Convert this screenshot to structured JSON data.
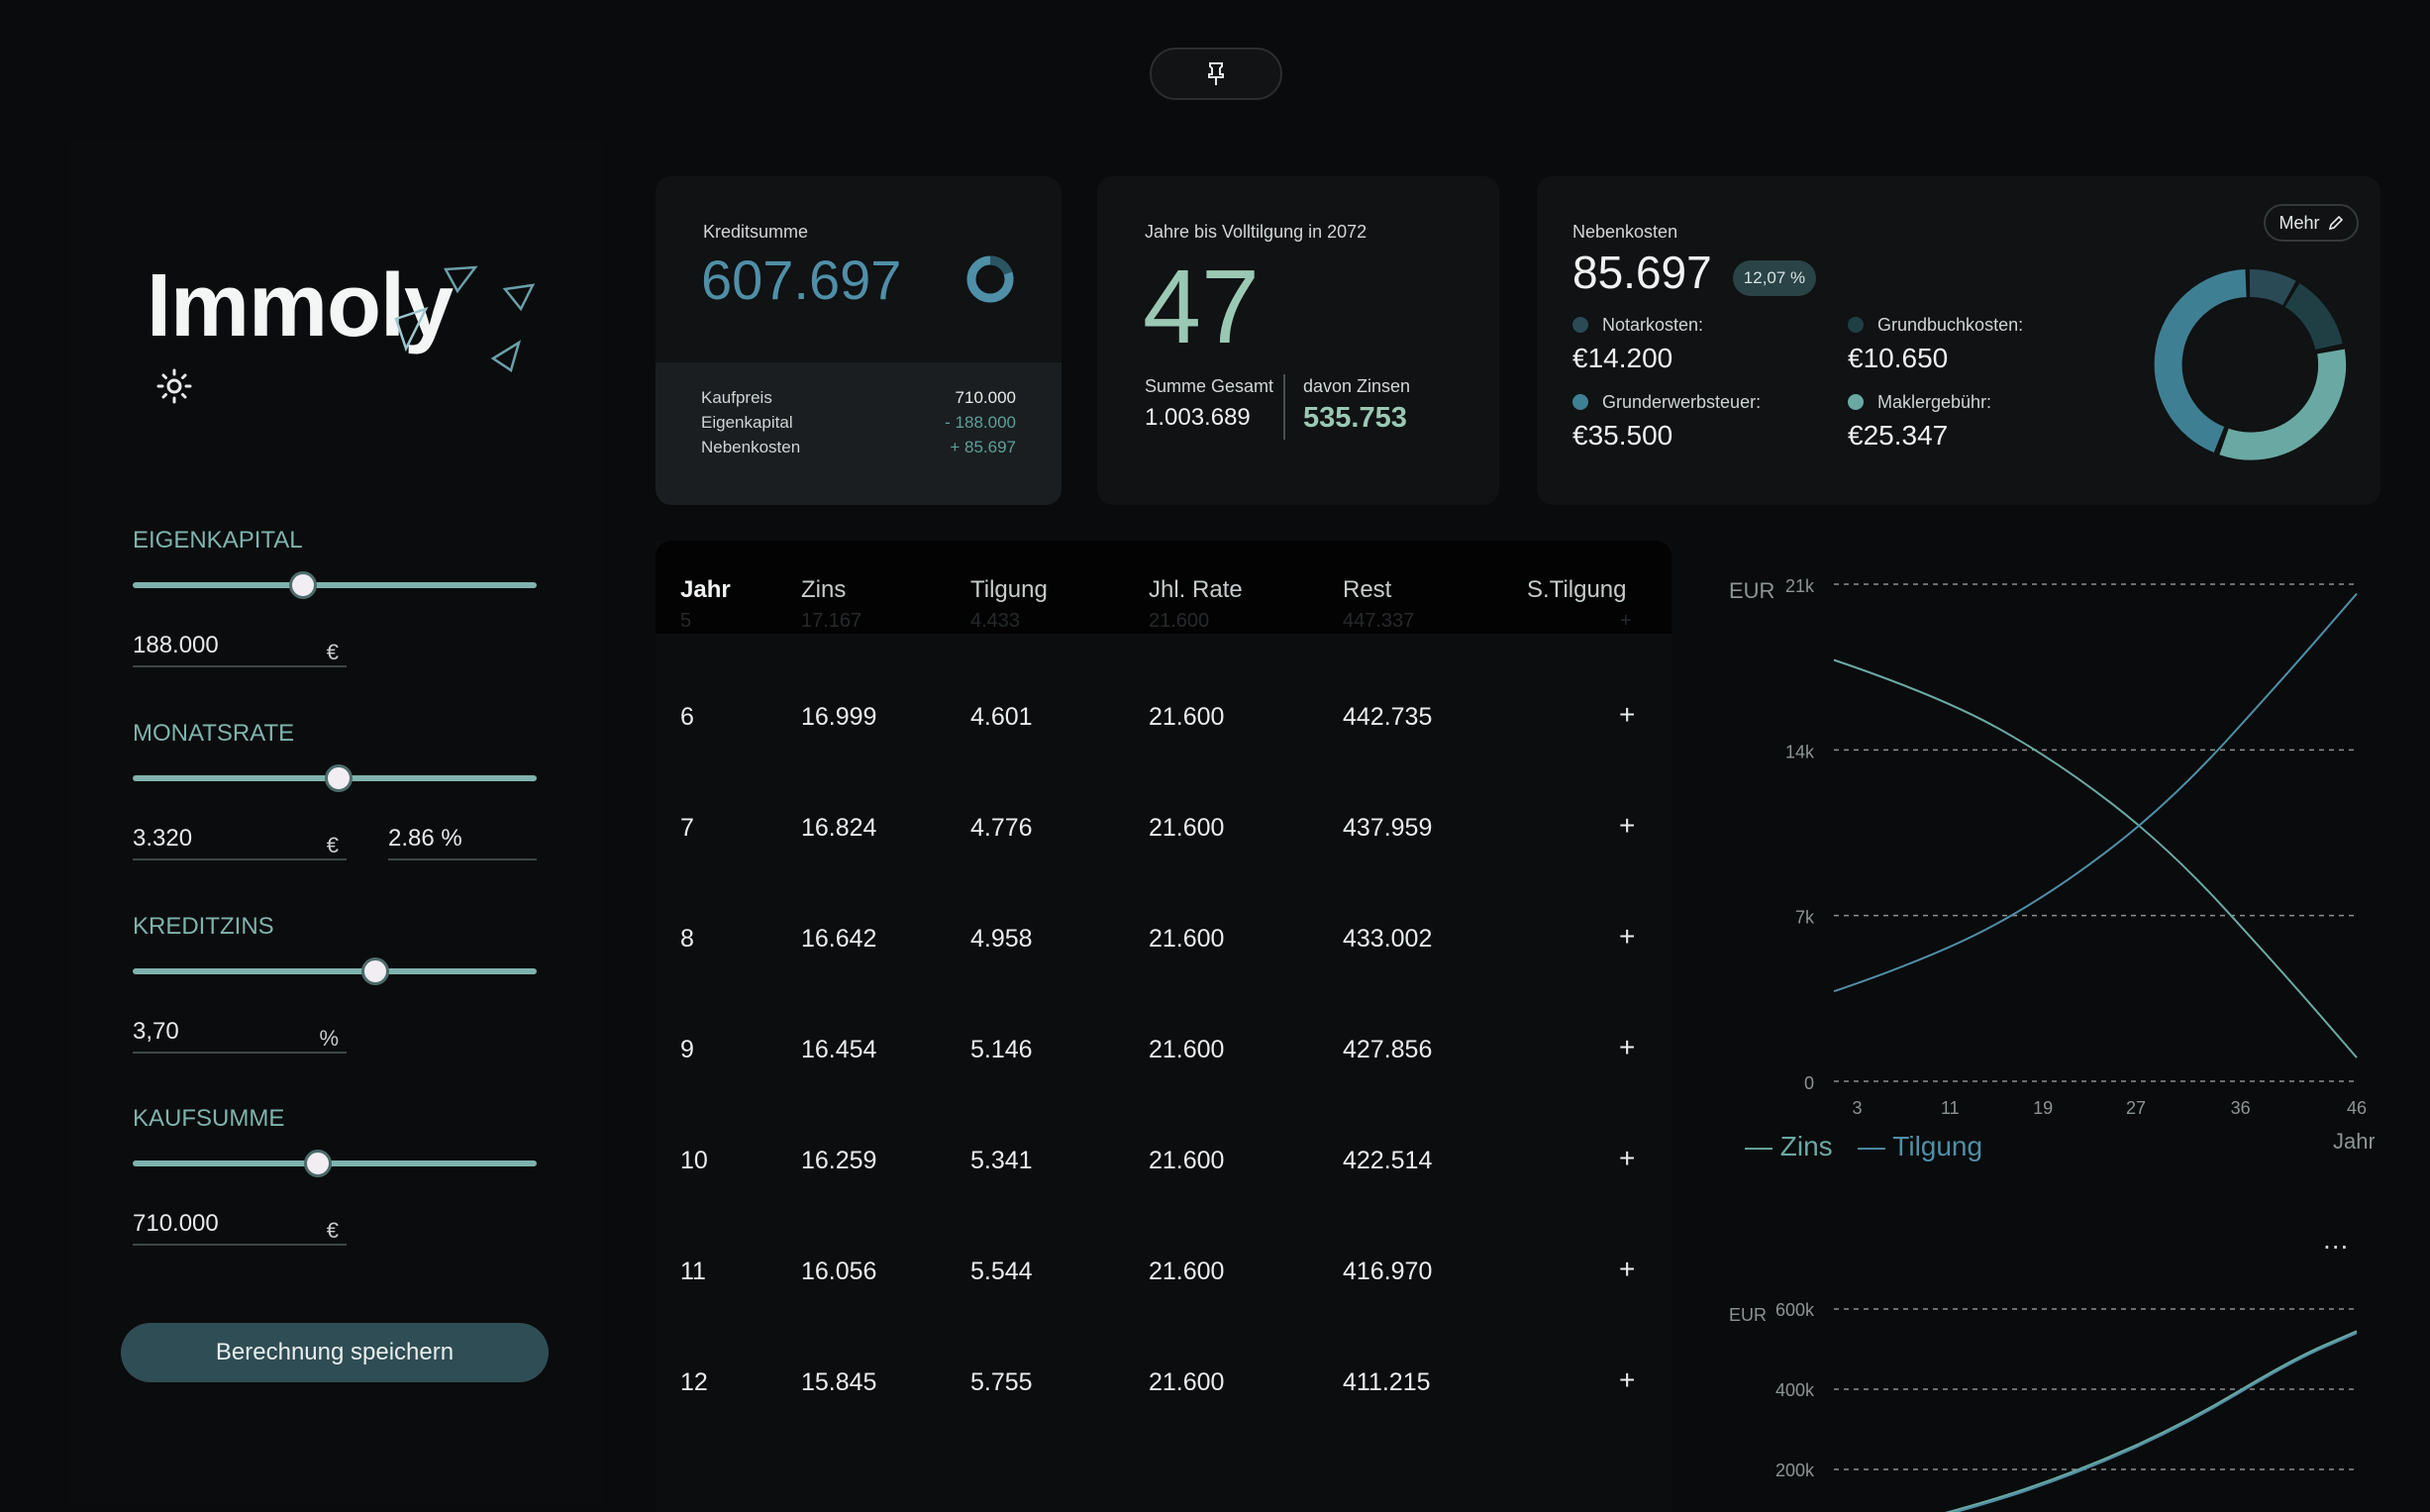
{
  "app": {
    "logo": "Immoly"
  },
  "top_pill": {
    "icon": "pin-icon"
  },
  "sidebar": {
    "controls": [
      {
        "label": "EIGENKAPITAL",
        "value": "188.000",
        "unit": "€",
        "slider_fraction": 0.42
      },
      {
        "label": "MONATSRATE",
        "value": "3.320",
        "unit": "€",
        "extra_value": "2.86 %",
        "slider_fraction": 0.51
      },
      {
        "label": "KREDITZINS",
        "value": "3,70",
        "unit": "%",
        "slider_fraction": 0.6
      },
      {
        "label": "KAUFSUMME",
        "value": "710.000",
        "unit": "€",
        "slider_fraction": 0.46
      }
    ],
    "save_label": "Berechnung speichern"
  },
  "credit_card": {
    "label": "Kreditsumme",
    "value": "607.697",
    "rows": [
      {
        "label": "Kaufpreis",
        "value": "710.000"
      },
      {
        "label": "Eigenkapital",
        "value": "- 188.000"
      },
      {
        "label": "Nebenkosten",
        "value": "+ 85.697"
      }
    ]
  },
  "years_card": {
    "label": "Jahre bis Volltilgung in 2072",
    "value": "47",
    "total_label": "Summe Gesamt",
    "total_value": "1.003.689",
    "interest_label": "davon Zinsen",
    "interest_value": "535.753"
  },
  "costs_card": {
    "label": "Nebenkosten",
    "value": "85.697",
    "badge": "12,07 %",
    "mehr": "Mehr",
    "items": [
      {
        "label": "Notarkosten:",
        "value": "€14.200",
        "color": "#2a4a56"
      },
      {
        "label": "Grundbuchkosten:",
        "value": "€10.650",
        "color": "#1f3f45"
      },
      {
        "label": "Grunderwerbsteuer:",
        "value": "€35.500",
        "color": "#3f7f94"
      },
      {
        "label": "Maklergebühr:",
        "value": "€25.347",
        "color": "#6aa9a3"
      }
    ]
  },
  "table": {
    "headers": [
      "Jahr",
      "Zins",
      "Tilgung",
      "Jhl. Rate",
      "Rest",
      "S.Tilgung"
    ],
    "ghost_row": [
      "5",
      "17.167",
      "4.433",
      "21.600",
      "447.337",
      "+"
    ],
    "rows": [
      [
        "6",
        "16.999",
        "4.601",
        "21.600",
        "442.735",
        "+"
      ],
      [
        "7",
        "16.824",
        "4.776",
        "21.600",
        "437.959",
        "+"
      ],
      [
        "8",
        "16.642",
        "4.958",
        "21.600",
        "433.002",
        "+"
      ],
      [
        "9",
        "16.454",
        "5.146",
        "21.600",
        "427.856",
        "+"
      ],
      [
        "10",
        "16.259",
        "5.341",
        "21.600",
        "422.514",
        "+"
      ],
      [
        "11",
        "16.056",
        "5.544",
        "21.600",
        "416.970",
        "+"
      ],
      [
        "12",
        "15.845",
        "5.755",
        "21.600",
        "411.215",
        "+"
      ]
    ]
  },
  "chart_data": [
    {
      "type": "line",
      "ylabel": "EUR",
      "xlabel": "Jahr",
      "y_ticks": [
        "0",
        "7k",
        "14k",
        "21k"
      ],
      "x_ticks": [
        "3",
        "11",
        "19",
        "27",
        "36",
        "46"
      ],
      "ylim": [
        0,
        21000
      ],
      "xlim": [
        1,
        46
      ],
      "series": [
        {
          "name": "Zins",
          "color": "#6aa9a3",
          "x": [
            1,
            10,
            20,
            30,
            40,
            46
          ],
          "y": [
            17800,
            16300,
            13600,
            9800,
            4400,
            1000
          ]
        },
        {
          "name": "Tilgung",
          "color": "#4f8fa8",
          "x": [
            1,
            10,
            20,
            30,
            40,
            46
          ],
          "y": [
            3800,
            5300,
            8000,
            11800,
            17200,
            20600
          ]
        }
      ],
      "legend": "bottom-left"
    },
    {
      "type": "line",
      "ylabel": "EUR",
      "menu": "...",
      "y_ticks": [
        "200k",
        "400k",
        "600k"
      ],
      "series": [
        {
          "color": "#4f8fa8",
          "x": [
            1,
            10,
            20,
            30,
            40,
            46
          ],
          "y": [
            40000,
            100000,
            190000,
            310000,
            470000,
            540000
          ]
        },
        {
          "color": "#6aa9a3",
          "x": [
            1,
            10,
            20,
            30,
            40,
            46
          ],
          "y": [
            45000,
            105000,
            195000,
            315000,
            475000,
            545000
          ]
        }
      ]
    }
  ]
}
